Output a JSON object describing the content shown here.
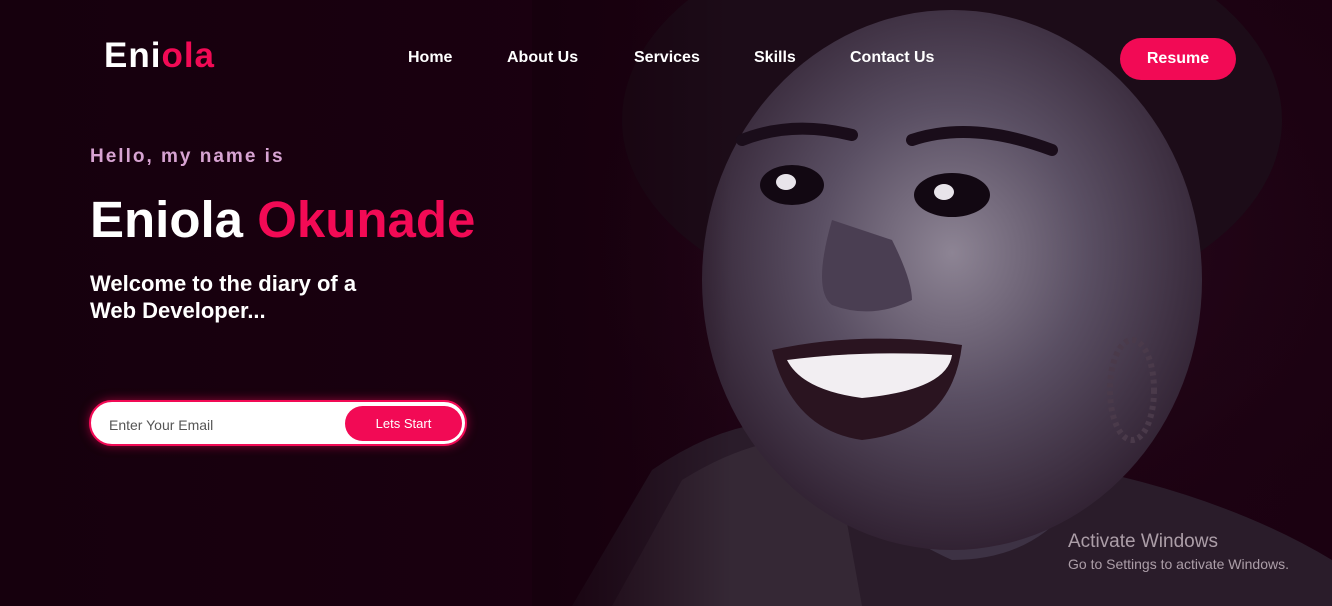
{
  "nav": {
    "logo_first": "Eni",
    "logo_second": "ola",
    "links": [
      "Home",
      "About Us",
      "Services",
      "Skills",
      "Contact Us"
    ],
    "resume_label": "Resume"
  },
  "hero": {
    "greeting": "Hello, my name is",
    "first_name": "Eniola",
    "last_name": "Okunade",
    "tagline_line1": "Welcome to the diary of a",
    "tagline_line2": "Web Developer..."
  },
  "signup": {
    "email_placeholder": "Enter Your Email",
    "email_value": "",
    "button_label": "Lets Start"
  },
  "watermark": {
    "title": "Activate Windows",
    "subtitle": "Go to Settings to activate Windows."
  },
  "colors": {
    "accent": "#f20a55",
    "background": "#16000d",
    "greeting": "#d7a3d2"
  }
}
